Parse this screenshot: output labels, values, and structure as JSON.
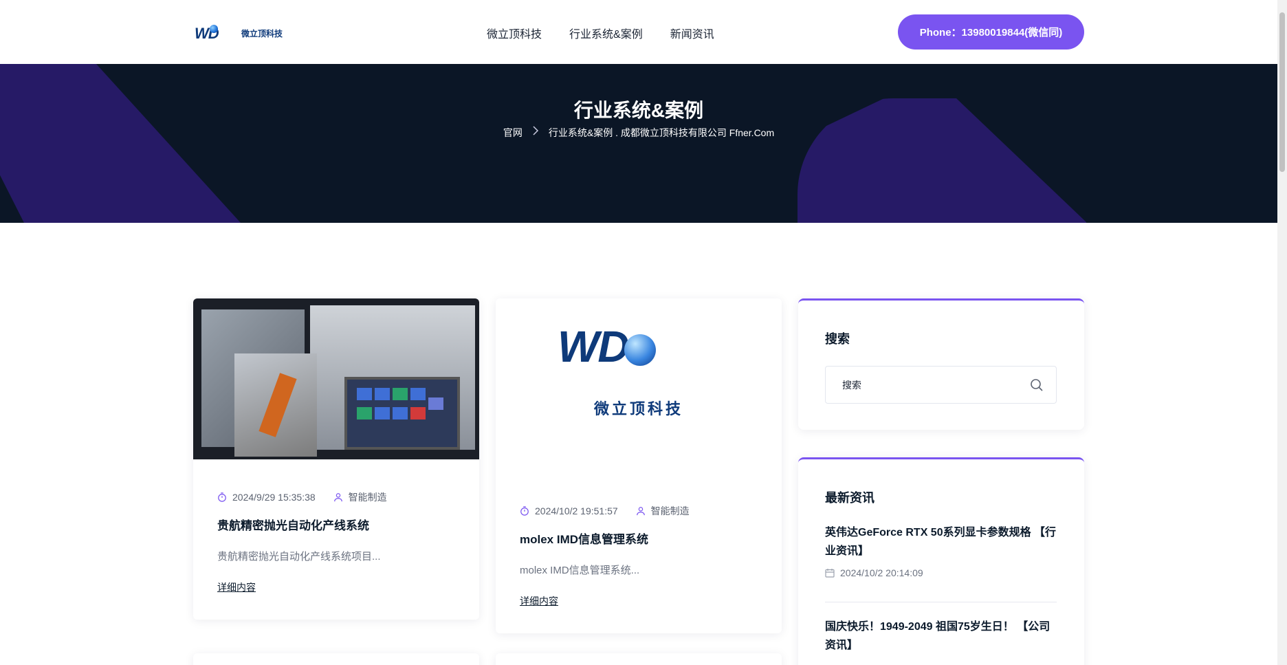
{
  "header": {
    "logo_text": "微立顶科技",
    "logo_mark": "WD",
    "nav": [
      "微立顶科技",
      "行业系统&案例",
      "新闻资讯"
    ],
    "phone": "Phone：13980019844(微信同)"
  },
  "banner": {
    "title": "行业系统&案例",
    "crumb_home": "官网",
    "crumb_current": "行业系统&案例 . 成都微立顶科技有限公司 Ffner.Com"
  },
  "posts": [
    {
      "date": "2024/9/29 15:35:38",
      "category": "智能制造",
      "title": "贵航精密抛光自动化产线系统",
      "excerpt": "贵航精密抛光自动化产线系统项目...",
      "link": "详细内容"
    },
    {
      "logo_mark": "WD",
      "logo_cn": "微立顶科技",
      "date": "2024/10/2 19:51:57",
      "category": "智能制造",
      "title": "molex IMD信息管理系统",
      "excerpt": "molex IMD信息管理系统...",
      "link": "详细内容"
    }
  ],
  "sidebar": {
    "search_title": "搜索",
    "search_placeholder": "搜索",
    "news_title": "最新资讯",
    "news": [
      {
        "title": "英伟达GeForce RTX 50系列显卡参数规格 【行业资讯】",
        "date": "2024/10/2 20:14:09"
      },
      {
        "title": "国庆快乐！1949-2049 祖国75岁生日！ 【公司资讯】"
      }
    ]
  },
  "colors": {
    "accent": "#7a54f0",
    "banner_bg": "#0b1626",
    "banner_shape": "#261a66",
    "text": "#0b1a2b"
  }
}
